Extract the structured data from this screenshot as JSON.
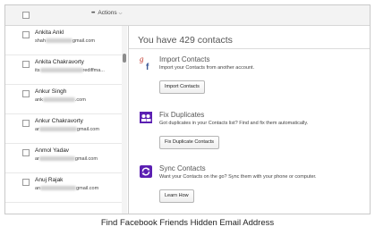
{
  "toolbar": {
    "actions_label": "Actions"
  },
  "contacts": [
    {
      "name": "Ankita Ankl",
      "email_prefix": "shah",
      "email_suffix": "gmail.com"
    },
    {
      "name": "Ankita Chakravorty",
      "email_prefix": "its",
      "email_suffix": "rediffma..."
    },
    {
      "name": "Ankur Singh",
      "email_prefix": "ank",
      "email_suffix": ".com"
    },
    {
      "name": "Ankur Chakravorty",
      "email_prefix": "ar",
      "email_suffix": "gmail.com"
    },
    {
      "name": "Anmol Yadav",
      "email_prefix": "ar",
      "email_suffix": "gmail.com"
    },
    {
      "name": "Anuj Rajak",
      "email_prefix": "an",
      "email_suffix": "gmail.com"
    }
  ],
  "panel": {
    "header": "You have 429 contacts",
    "sections": [
      {
        "title": "Import Contacts",
        "desc": "Import your Contacts from another account.",
        "button": "Import Contacts",
        "icon": "google-facebook-icon"
      },
      {
        "title": "Fix Duplicates",
        "desc": "Got duplicates in your Contacts list? Find and fix them automatically.",
        "button": "Fix Duplicate Contacts",
        "icon": "duplicate-contacts-icon"
      },
      {
        "title": "Sync Contacts",
        "desc": "Want your Contacts on the go? Sync them with your phone or computer.",
        "button": "Learn How",
        "icon": "sync-icon"
      }
    ]
  },
  "caption": "Find Facebook Friends Hidden Email Address",
  "colors": {
    "brand_purple": "#5b1fb2",
    "google_red": "#c1372c",
    "facebook_blue": "#3b5998"
  }
}
